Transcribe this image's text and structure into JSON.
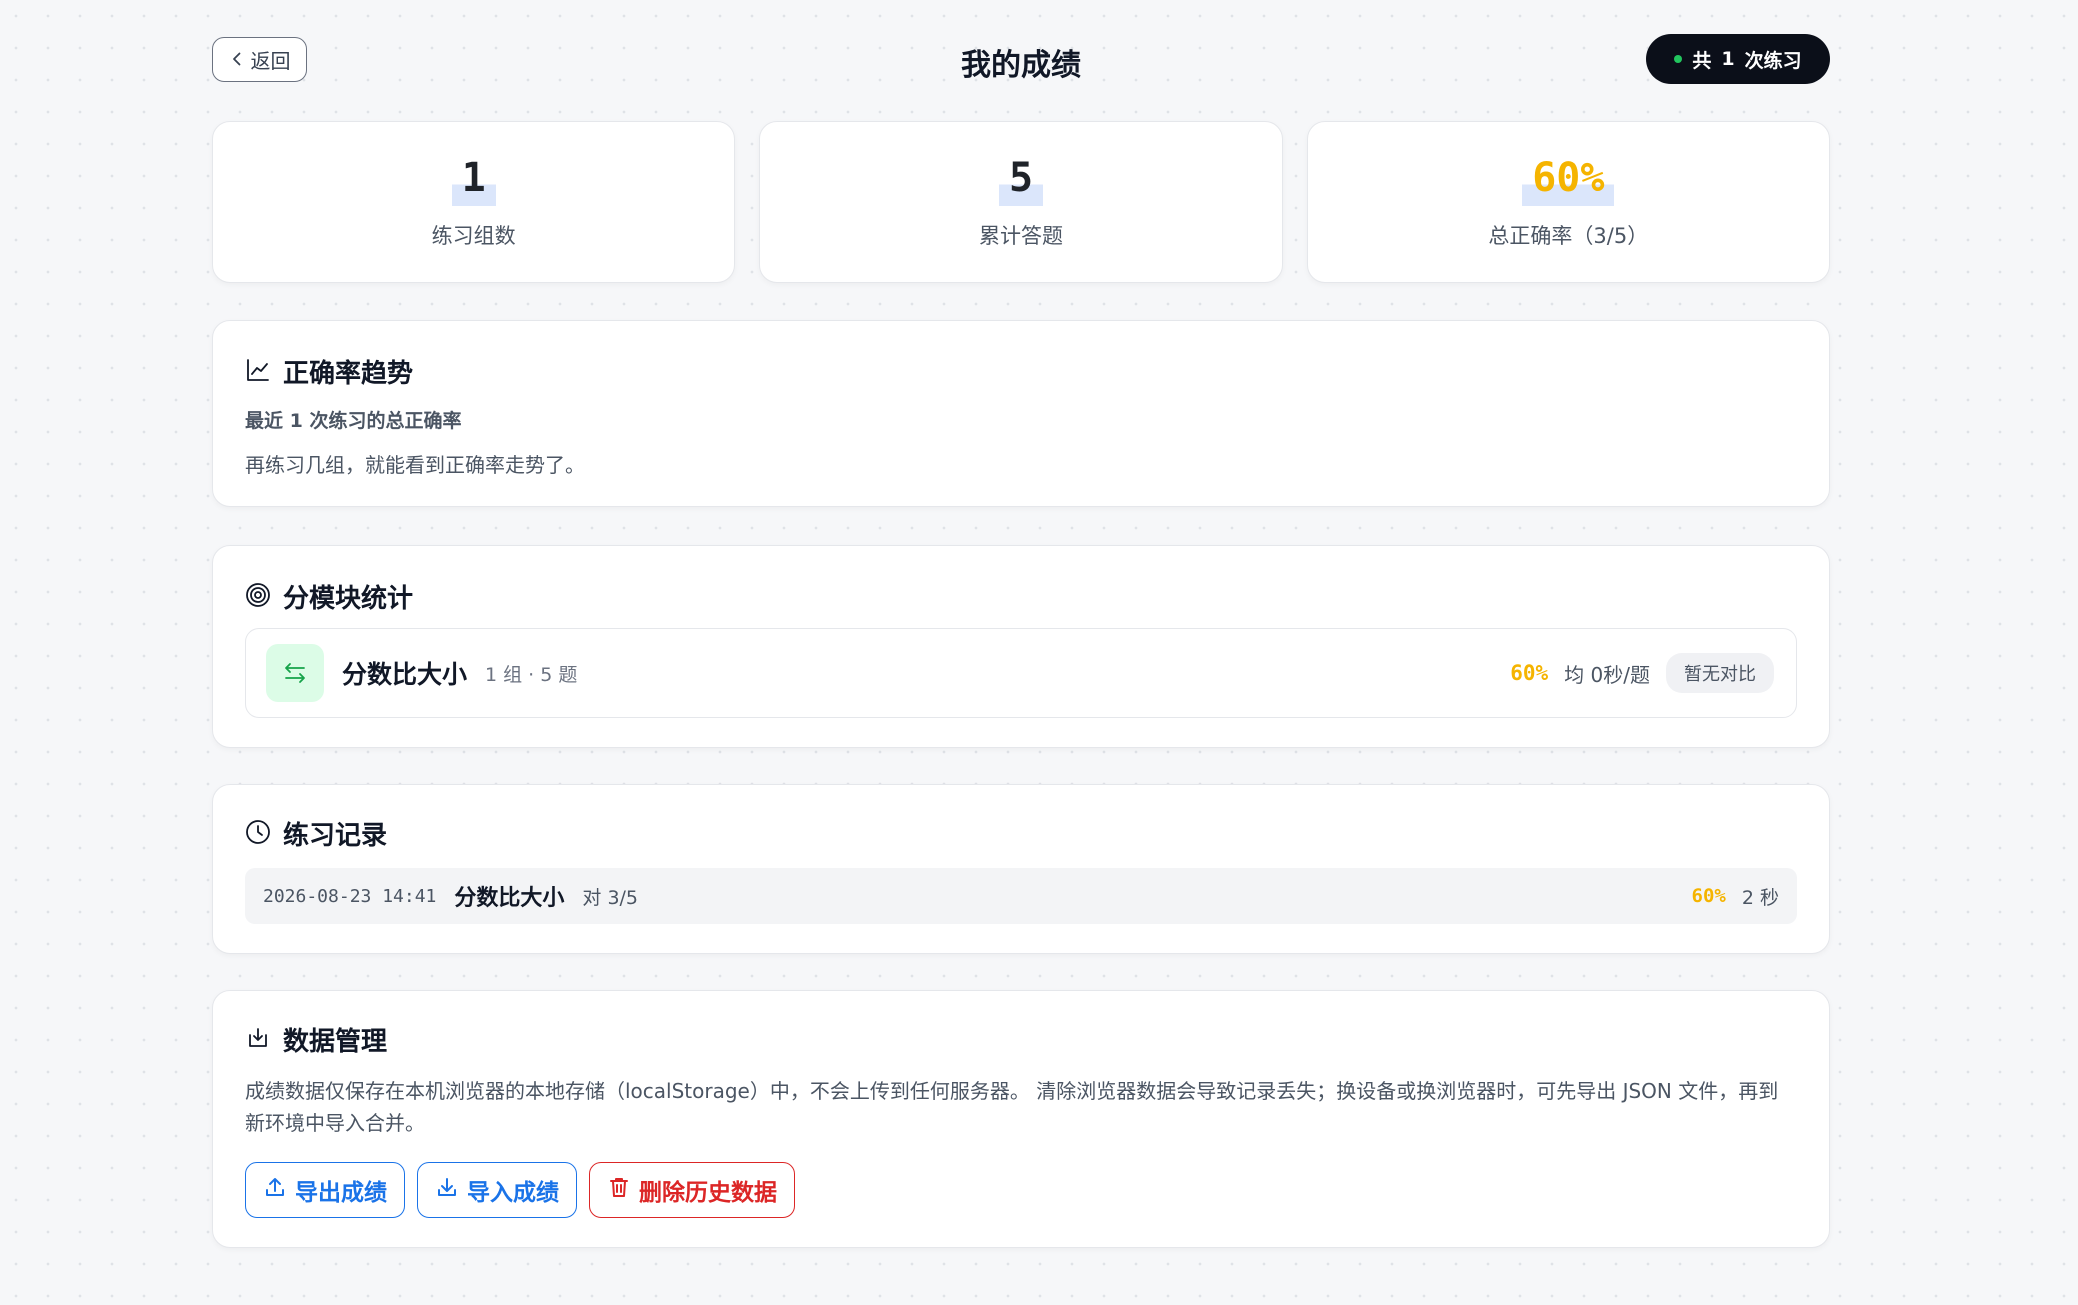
{
  "header": {
    "back_label": "返回",
    "title": "我的成绩",
    "count_prefix": "共",
    "count_value": "1",
    "count_suffix": "次练习"
  },
  "stats": [
    {
      "value": "1",
      "label": "练习组数"
    },
    {
      "value": "5",
      "label": "累计答题"
    },
    {
      "value": "60%",
      "label": "总正确率（3/5）"
    }
  ],
  "trend": {
    "title": "正确率趋势",
    "subtitle": "最近 1 次练习的总正确率",
    "empty_message": "再练习几组，就能看到正确率走势了。"
  },
  "modules": {
    "title": "分模块统计",
    "items": [
      {
        "name": "分数比大小",
        "meta": "1 组 · 5 题",
        "accuracy": "60%",
        "avg_time": "均 0秒/题",
        "compare": "暂无对比"
      }
    ]
  },
  "records": {
    "title": "练习记录",
    "items": [
      {
        "time": "2026-08-23 14:41",
        "name": "分数比大小",
        "score": "对 3/5",
        "accuracy": "60%",
        "duration": "2 秒"
      }
    ]
  },
  "data_mgmt": {
    "title": "数据管理",
    "description": "成绩数据仅保存在本机浏览器的本地存储（localStorage）中，不会上传到任何服务器。 清除浏览器数据会导致记录丢失；换设备或换浏览器时，可先导出 JSON 文件，再到新环境中导入合并。",
    "export_label": "导出成绩",
    "import_label": "导入成绩",
    "delete_label": "删除历史数据"
  },
  "colors": {
    "accent_yellow": "#f5b400",
    "primary_blue": "#1a73e8",
    "danger_red": "#dc2626",
    "pill_dark": "#0b0f19",
    "status_green": "#22c55e"
  }
}
